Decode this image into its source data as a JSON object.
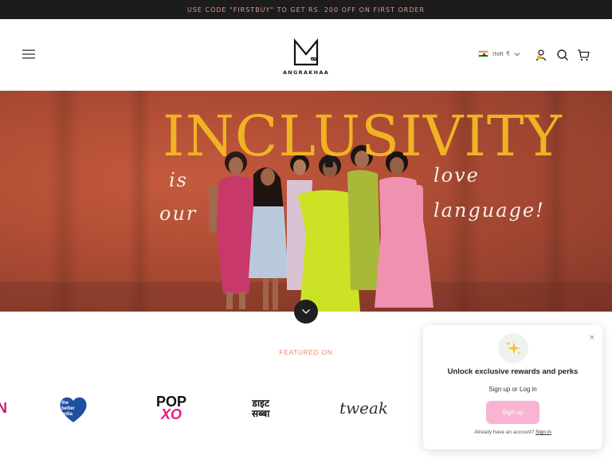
{
  "announcement": {
    "text": "USE CODE \"FIRSTBUY\" TO GET RS. 200 OFF ON FIRST ORDER"
  },
  "header": {
    "logo_text": "ANGRAKHAA",
    "currency_label": "INR ₹",
    "icons": [
      "menu-icon",
      "india-flag-icon",
      "chevron-down-icon",
      "account-icon",
      "search-icon",
      "cart-icon"
    ]
  },
  "hero": {
    "title": "INCLUSIVITY",
    "script_left_1": "is",
    "script_left_2": "our",
    "script_right_1": "love",
    "script_right_2": "language!",
    "colors": {
      "title": "#f0b323",
      "background": "#b24e35"
    }
  },
  "featured": {
    "label": "FEATURED ON",
    "logos": [
      {
        "name": "partial-logo",
        "text": "N"
      },
      {
        "name": "the-better-india",
        "line1": "the",
        "line2": "better",
        "line3": "india"
      },
      {
        "name": "popxo",
        "line1": "POP",
        "line2": "XO"
      },
      {
        "name": "dainik-script",
        "line1": "डाइट",
        "line2": "सब्बा"
      },
      {
        "name": "tweak",
        "text": "tweak"
      }
    ]
  },
  "popup": {
    "icon": "sparkles-icon",
    "title": "Unlock exclusive rewards and perks",
    "subtitle": "Sign up or Log in",
    "button_label": "Sign up",
    "footer_text": "Already have an account?",
    "footer_link": "Sign in",
    "close_label": "×",
    "colors": {
      "button": "#f8b4d2"
    }
  }
}
